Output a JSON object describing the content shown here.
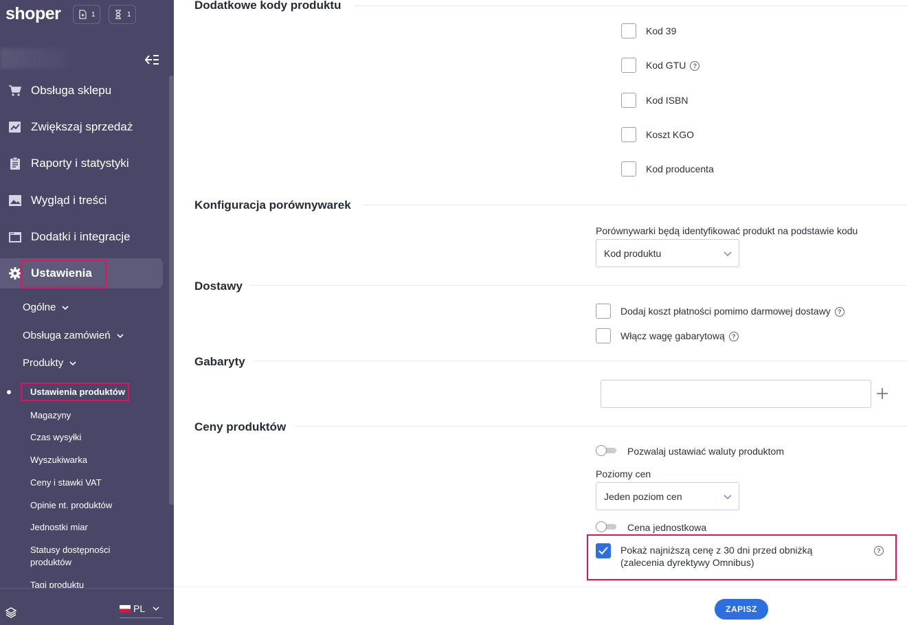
{
  "brand": {
    "logo": "shoper",
    "accent": "#2e6fe0",
    "sidebar_bg": "#4a4668",
    "highlight": "#e2135c"
  },
  "header": {
    "badge1_count": "1",
    "badge1_icon": "file-plus-icon",
    "badge2_count": "1",
    "badge2_icon": "hourglass-icon"
  },
  "sidebar": {
    "nav": [
      {
        "label": "Obsługa sklepu",
        "icon": "cart-icon"
      },
      {
        "label": "Zwiększaj sprzedaż",
        "icon": "chart-icon"
      },
      {
        "label": "Raporty i statystyki",
        "icon": "clipboard-icon"
      },
      {
        "label": "Wygląd i treści",
        "icon": "image-icon"
      },
      {
        "label": "Dodatki i integracje",
        "icon": "window-icon"
      },
      {
        "label": "Ustawienia",
        "icon": "gear-icon"
      }
    ],
    "sub": [
      "Ogólne",
      "Obsługa zamówień",
      "Produkty"
    ],
    "leaves": [
      "Ustawienia produktów",
      "Magazyny",
      "Czas wysyłki",
      "Wyszukiwarka",
      "Ceny i stawki VAT",
      "Opinie nt. produktów",
      "Jednostki miar",
      "Statusy dostępności produktów",
      "Tagi produktu"
    ],
    "language": "PL"
  },
  "main": {
    "codes": {
      "title": "Dodatkowe kody produktu",
      "items": [
        "Kod 39",
        "Kod GTU",
        "Kod ISBN",
        "Koszt KGO",
        "Kod producenta"
      ]
    },
    "comparators": {
      "title": "Konfiguracja porównywarek",
      "field_label": "Porównywarki będą identyfikować produkt na podstawie kodu",
      "selected": "Kod produktu"
    },
    "delivery": {
      "title": "Dostawy",
      "opt1": "Dodaj koszt płatności pomimo darmowej dostawy",
      "opt2": "Włącz wagę gabarytową"
    },
    "dimensions": {
      "title": "Gabaryty",
      "value": ""
    },
    "prices": {
      "title": "Ceny produktów",
      "toggle1": "Pozwalaj ustawiać waluty produktom",
      "levels_label": "Poziomy cen",
      "levels_selected": "Jeden poziom cen",
      "toggle2": "Cena jednostkowa",
      "omnibus": "Pokaż najniższą cenę z 30 dni przed obniżką (zalecenia dyrektywy Omnibus)",
      "omnibus_checked": true
    },
    "save_label": "ZAPISZ"
  }
}
